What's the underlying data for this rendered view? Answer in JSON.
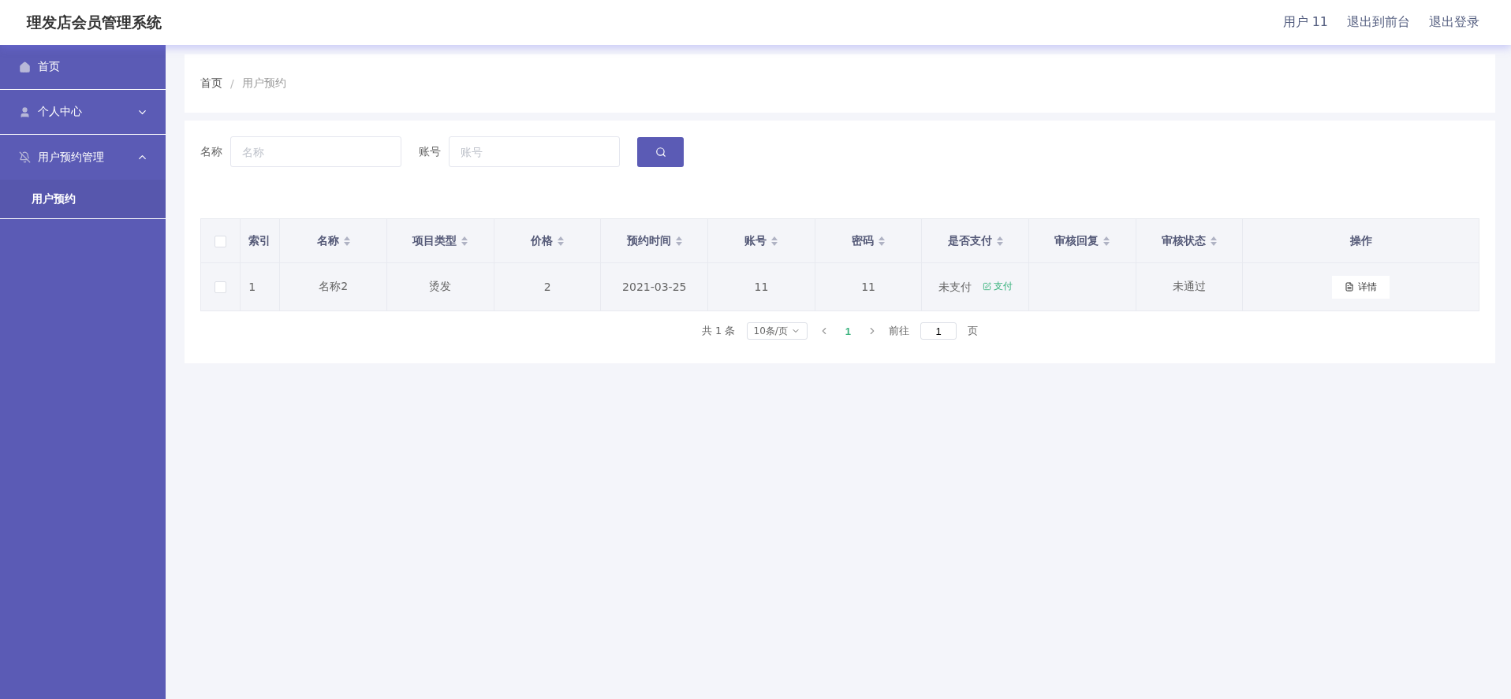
{
  "header": {
    "title": "理发店会员管理系统",
    "links": [
      "用户 11",
      "退出到前台",
      "退出登录"
    ]
  },
  "sidebar": {
    "items": [
      {
        "label": "首页"
      },
      {
        "label": "个人中心",
        "expanded": false
      },
      {
        "label": "用户预约管理",
        "expanded": true,
        "children": [
          {
            "label": "用户预约",
            "selected": true
          }
        ]
      }
    ]
  },
  "breadcrumb": {
    "separator": "/",
    "items": [
      "首页",
      "用户预约"
    ]
  },
  "search": {
    "fields": [
      {
        "label": "名称",
        "placeholder": "名称"
      },
      {
        "label": "账号",
        "placeholder": "账号"
      }
    ]
  },
  "table": {
    "select_all": {
      "checked": false
    },
    "columns": [
      {
        "label": "索引",
        "sortable": false
      },
      {
        "label": "名称",
        "sortable": true
      },
      {
        "label": "项目类型",
        "sortable": true
      },
      {
        "label": "价格",
        "sortable": true
      },
      {
        "label": "预约时间",
        "sortable": true
      },
      {
        "label": "账号",
        "sortable": true
      },
      {
        "label": "密码",
        "sortable": true
      },
      {
        "label": "是否支付",
        "sortable": true
      },
      {
        "label": "审核回复",
        "sortable": true
      },
      {
        "label": "审核状态",
        "sortable": true
      },
      {
        "label": "操作",
        "sortable": false
      }
    ],
    "rows": [
      {
        "checked": false,
        "cells": [
          "1",
          "名称2",
          "烫发",
          "2",
          "2021-03-25",
          "11",
          "11"
        ],
        "paid": "未支付",
        "pay_action": "支付",
        "status": "未通过",
        "action": "详情"
      }
    ]
  },
  "pagination": {
    "total": "共 1 条",
    "page_size": "10条/页",
    "pages": [
      {
        "label": "1",
        "selected": true
      }
    ],
    "goto_label": "前往",
    "goto_value": "1",
    "goto_suffix": "页"
  }
}
